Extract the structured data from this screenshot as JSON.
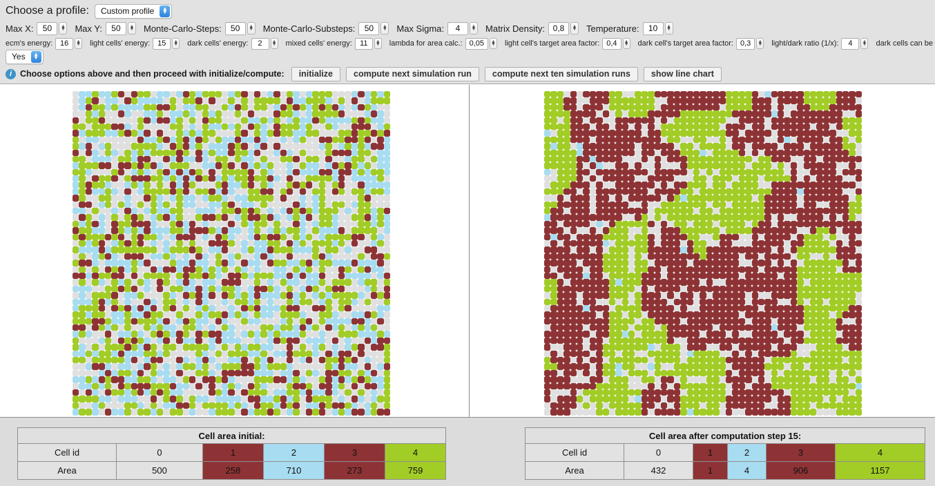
{
  "header": {
    "profile_label": "Choose a profile:",
    "profile_value": "Custom profile",
    "params_row1": [
      {
        "label": "Max X:",
        "value": "50"
      },
      {
        "label": "Max Y:",
        "value": "50"
      },
      {
        "label": "Monte-Carlo-Steps:",
        "value": "50"
      },
      {
        "label": "Monte-Carlo-Substeps:",
        "value": "50"
      },
      {
        "label": "Max Sigma:",
        "value": "4"
      },
      {
        "label": "Matrix Density:",
        "value": "0,8"
      },
      {
        "label": "Temperature:",
        "value": "10"
      }
    ],
    "params_row2": [
      {
        "label": "ecm's energy:",
        "value": "16"
      },
      {
        "label": "light cells' energy:",
        "value": "15"
      },
      {
        "label": "dark cells' energy:",
        "value": "2"
      },
      {
        "label": "mixed cells' energy:",
        "value": "11"
      },
      {
        "label": "lambda for area calc.:",
        "value": "0,05"
      },
      {
        "label": "light cell's target area factor:",
        "value": "0,4"
      },
      {
        "label": "dark cell's target area factor:",
        "value": "0,3"
      },
      {
        "label": "light/dark ratio (1/x):",
        "value": "4"
      }
    ],
    "eradicated_label": "dark cells can be eradicated:",
    "eradicated_value": "Yes",
    "info_text": "Choose options above and then proceed with initialize/compute:",
    "info_icon": "info-icon",
    "buttons": [
      "initialize",
      "compute next simulation run",
      "compute next ten simulation runs",
      "show line chart"
    ]
  },
  "colors": {
    "green": "#a2cc26",
    "blue": "#a8dcf0",
    "dark_red": "#8e3335",
    "gray": "#e0e0e0",
    "white": "#ffffff",
    "panel_bg": "#e2e2e2",
    "footer_bg": "#dcdcdc",
    "accent_blue": "#3e93c8"
  },
  "grids": {
    "columns": 49,
    "rows": 50,
    "left": {
      "name": "initial-cell-grid",
      "weights": {
        "green": 0.3,
        "blue": 0.27,
        "gray": 0.26,
        "dark_red": 0.17
      },
      "seed": 20110
    },
    "right": {
      "name": "computed-cell-grid",
      "weights": {
        "green": 0.4,
        "dark_red": 0.4,
        "gray": 0.19,
        "blue": 0.01
      },
      "seed": 77341
    }
  },
  "tables": {
    "left": {
      "title": "Cell area initial:",
      "row_labels": [
        "Cell id",
        "Area"
      ],
      "cells": [
        {
          "id": "0",
          "area": "500",
          "color": "default",
          "width": 125
        },
        {
          "id": "1",
          "area": "258",
          "color": "dark",
          "width": 88
        },
        {
          "id": "2",
          "area": "710",
          "color": "blue",
          "width": 88
        },
        {
          "id": "3",
          "area": "273",
          "color": "dark",
          "width": 88
        },
        {
          "id": "4",
          "area": "759",
          "color": "green",
          "width": 88
        }
      ],
      "label_col_width": 143
    },
    "right": {
      "title": "Cell area after computation step 15:",
      "row_labels": [
        "Cell id",
        "Area"
      ],
      "cells": [
        {
          "id": "0",
          "area": "432",
          "color": "default",
          "width": 100
        },
        {
          "id": "1",
          "area": "1",
          "color": "dark",
          "width": 50
        },
        {
          "id": "2",
          "area": "4",
          "color": "blue",
          "width": 56
        },
        {
          "id": "3",
          "area": "906",
          "color": "dark",
          "width": 100
        },
        {
          "id": "4",
          "area": "1157",
          "color": "green",
          "width": 130
        }
      ],
      "label_col_width": 143
    }
  }
}
